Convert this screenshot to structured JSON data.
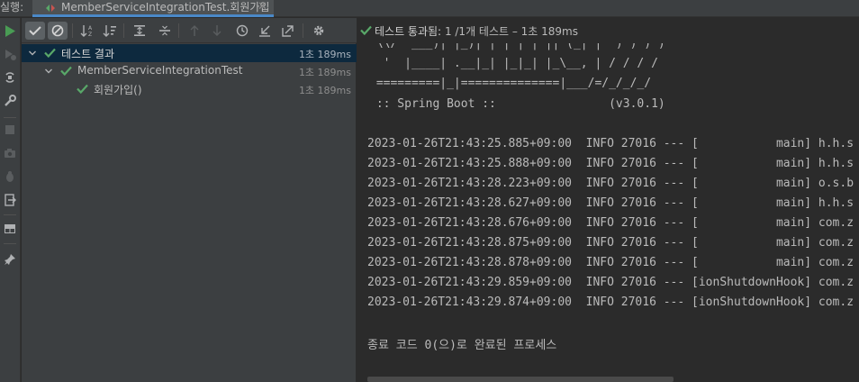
{
  "tabbar": {
    "run_label": "실행:",
    "tab_title": "MemberServiceIntegrationTest.회원가입",
    "close_glyph": "✕"
  },
  "status": {
    "label": "테스트 통과됨:",
    "detail": "1 /1개 테스트 – 1초 189ms"
  },
  "tree": {
    "rows": [
      {
        "label": "테스트 결과",
        "time": "1초 189ms"
      },
      {
        "label": "MemberServiceIntegrationTest",
        "time": "1초 189ms"
      },
      {
        "label": "회원가입()",
        "time": "1초 189ms"
      }
    ]
  },
  "console": {
    "banner": [
      " \\\\/  ___)| |_)| | | | | || (_| |  ) ) ) )",
      "  '  |____| .__|_| |_|_| |_\\__, | / / / /",
      " =========|_|==============|___/=/_/_/_/",
      " :: Spring Boot ::                (v3.0.1)"
    ],
    "logs": [
      "2023-01-26T21:43:25.885+09:00  INFO 27016 --- [           main] h.h.s",
      "2023-01-26T21:43:25.888+09:00  INFO 27016 --- [           main] h.h.s",
      "2023-01-26T21:43:28.223+09:00  INFO 27016 --- [           main] o.s.b",
      "2023-01-26T21:43:28.627+09:00  INFO 27016 --- [           main] h.h.s",
      "2023-01-26T21:43:28.676+09:00  INFO 27016 --- [           main] com.z",
      "2023-01-26T21:43:28.875+09:00  INFO 27016 --- [           main] com.z",
      "2023-01-26T21:43:28.878+09:00  INFO 27016 --- [           main] com.z",
      "2023-01-26T21:43:29.859+09:00  INFO 27016 --- [ionShutdownHook] com.z",
      "2023-01-26T21:43:29.874+09:00  INFO 27016 --- [ionShutdownHook] com.z"
    ],
    "exit": "종료 코드 0(으)로 완료된 프로세스"
  },
  "colors": {
    "pass_green": "#59a869",
    "run_green": "#499c54",
    "selection": "#0d293e",
    "tab_underline": "#4a88c7"
  }
}
